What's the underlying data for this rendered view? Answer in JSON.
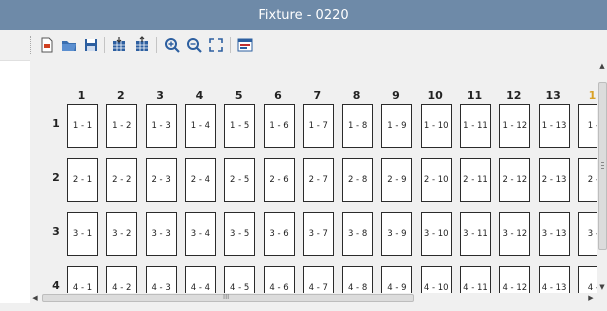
{
  "window": {
    "title": "Fixture - 0220"
  },
  "toolbar": {
    "buttons": [
      {
        "id": "new",
        "icon": "new-file-icon",
        "color": "#d04020"
      },
      {
        "id": "open",
        "icon": "open-folder-icon",
        "color": "#3a6fb0"
      },
      {
        "id": "save",
        "icon": "save-icon",
        "color": "#2d5fa0"
      },
      {
        "id": "import",
        "icon": "import-grid-icon",
        "color": "#2d5fa0"
      },
      {
        "id": "export",
        "icon": "export-grid-icon",
        "color": "#2d5fa0"
      },
      {
        "id": "zoom-in",
        "icon": "zoom-in-icon",
        "color": "#2d5fa0"
      },
      {
        "id": "zoom-out",
        "icon": "zoom-out-icon",
        "color": "#2d5fa0"
      },
      {
        "id": "fit",
        "icon": "fit-to-window-icon",
        "color": "#2d5fa0"
      },
      {
        "id": "properties",
        "icon": "properties-icon",
        "color": "#c03030"
      }
    ]
  },
  "grid": {
    "columns": [
      "1",
      "2",
      "3",
      "4",
      "5",
      "6",
      "7",
      "8",
      "9",
      "10",
      "11",
      "12",
      "13",
      "1"
    ],
    "rows": [
      "1",
      "2",
      "3",
      "4"
    ],
    "cells": [
      [
        "1 - 1",
        "1 - 2",
        "1 - 3",
        "1 - 4",
        "1 - 5",
        "1 - 6",
        "1 - 7",
        "1 - 8",
        "1 - 9",
        "1 - 10",
        "1 - 11",
        "1 - 12",
        "1 - 13",
        "1 -"
      ],
      [
        "2 - 1",
        "2 - 2",
        "2 - 3",
        "2 - 4",
        "2 - 5",
        "2 - 6",
        "2 - 7",
        "2 - 8",
        "2 - 9",
        "2 - 10",
        "2 - 11",
        "2 - 12",
        "2 - 13",
        "2 -"
      ],
      [
        "3 - 1",
        "3 - 2",
        "3 - 3",
        "3 - 4",
        "3 - 5",
        "3 - 6",
        "3 - 7",
        "3 - 8",
        "3 - 9",
        "3 - 10",
        "3 - 11",
        "3 - 12",
        "3 - 13",
        "3 -"
      ],
      [
        "4 - 1",
        "4 - 2",
        "4 - 3",
        "4 - 4",
        "4 - 5",
        "4 - 6",
        "4 - 7",
        "4 - 8",
        "4 - 9",
        "4 - 10",
        "4 - 11",
        "4 - 12",
        "4 - 13",
        "4 -"
      ]
    ]
  },
  "scrollbars": {
    "horizontal_grip": "III",
    "vertical_grip": "≡"
  }
}
